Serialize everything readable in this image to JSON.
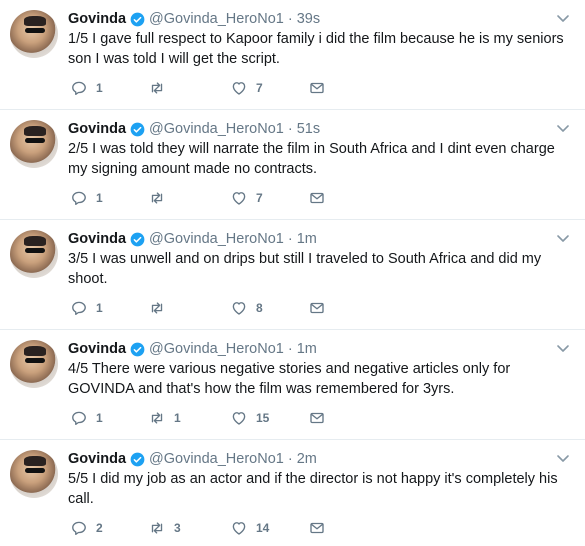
{
  "colors": {
    "verified_blue": "#1da1f2",
    "icon_gray": "#657786",
    "text": "#14171a",
    "divider": "#e6ecf0"
  },
  "icons": {
    "verified": "verified-badge-icon",
    "caret": "chevron-down-icon",
    "reply": "reply-icon",
    "retweet": "retweet-icon",
    "like": "heart-icon",
    "dm": "envelope-icon"
  },
  "tweets": [
    {
      "name": "Govinda",
      "handle": "@Govinda_HeroNo1",
      "dot": "·",
      "time": "39s",
      "text": "1/5 I gave full respect to Kapoor family i did the film because he is my seniors son I was told I will get the script.",
      "replies": "1",
      "retweets": "",
      "likes": "7"
    },
    {
      "name": "Govinda",
      "handle": "@Govinda_HeroNo1",
      "dot": "·",
      "time": "51s",
      "text": "2/5 I was told they will narrate the film in South Africa and I dint even charge my signing amount made no contracts.",
      "replies": "1",
      "retweets": "",
      "likes": "7"
    },
    {
      "name": "Govinda",
      "handle": "@Govinda_HeroNo1",
      "dot": "·",
      "time": "1m",
      "text": "3/5 I was unwell and on drips but still I traveled to South Africa and did my shoot.",
      "replies": "1",
      "retweets": "",
      "likes": "8"
    },
    {
      "name": "Govinda",
      "handle": "@Govinda_HeroNo1",
      "dot": "·",
      "time": "1m",
      "text": "4/5  There were various negative stories and negative articles only for GOVINDA and that's how the film was remembered for 3yrs.",
      "replies": "1",
      "retweets": "1",
      "likes": "15"
    },
    {
      "name": "Govinda",
      "handle": "@Govinda_HeroNo1",
      "dot": "·",
      "time": "2m",
      "text": "5/5 I did my job as an actor and if the director is not happy it's completely his call.",
      "replies": "2",
      "retweets": "3",
      "likes": "14"
    }
  ]
}
